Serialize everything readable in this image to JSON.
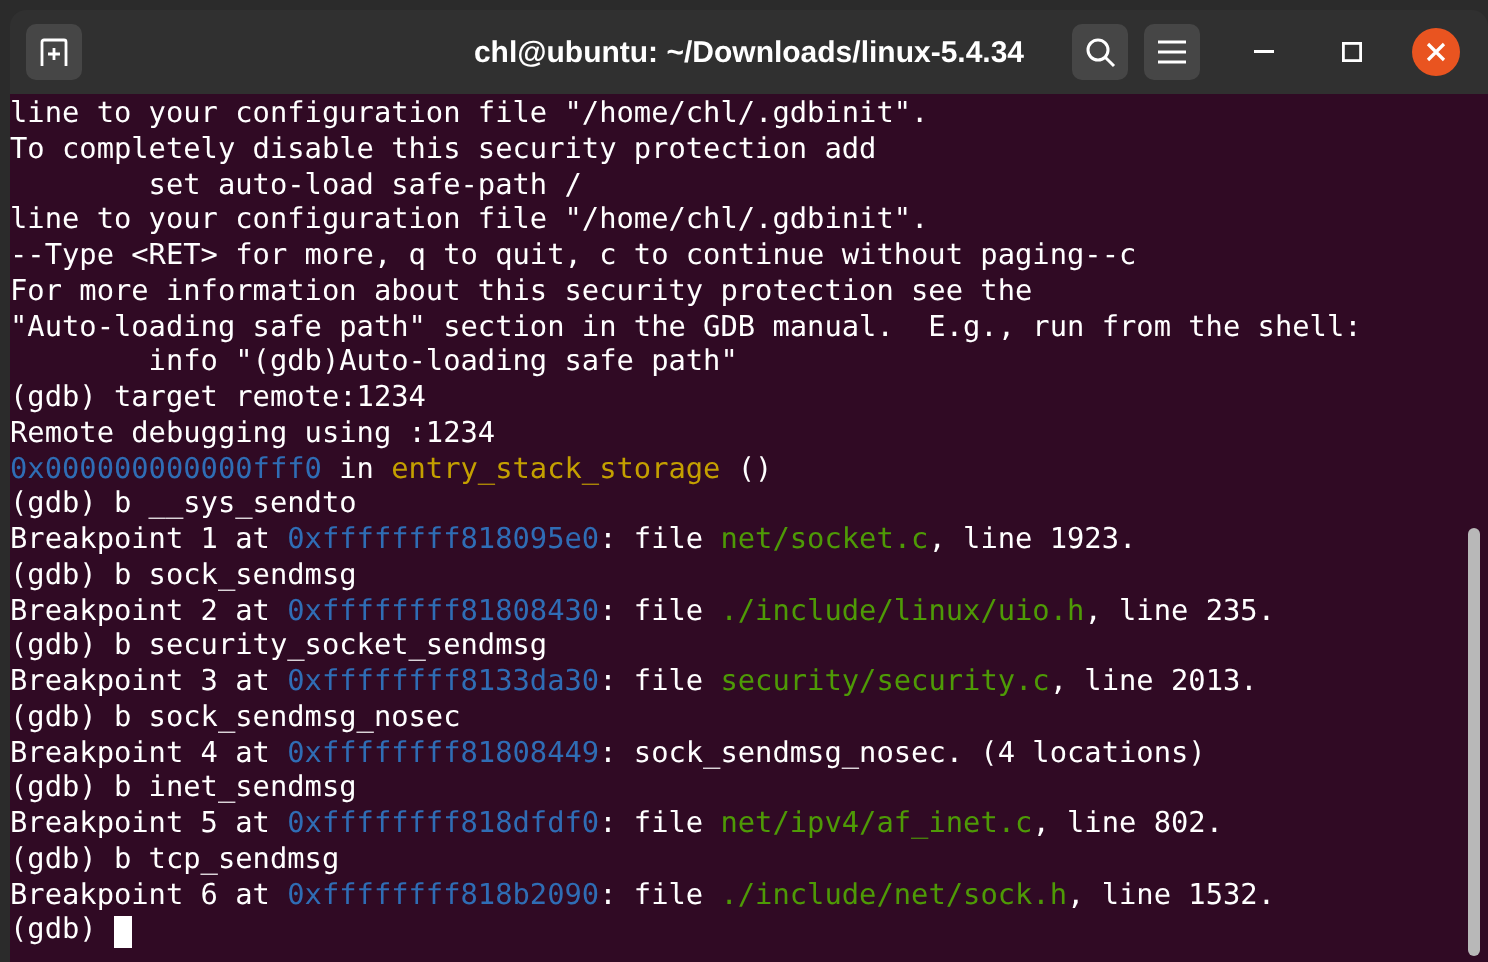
{
  "window": {
    "title": "chl@ubuntu: ~/Downloads/linux-5.4.34"
  },
  "terminal": {
    "lines": [
      {
        "segments": [
          {
            "kind": "plain",
            "text": "line to your configuration file \"/home/chl/.gdbinit\"."
          }
        ]
      },
      {
        "segments": [
          {
            "kind": "plain",
            "text": "To completely disable this security protection add"
          }
        ]
      },
      {
        "segments": [
          {
            "kind": "plain",
            "text": "        set auto-load safe-path /"
          }
        ]
      },
      {
        "segments": [
          {
            "kind": "plain",
            "text": "line to your configuration file \"/home/chl/.gdbinit\"."
          }
        ]
      },
      {
        "segments": [
          {
            "kind": "plain",
            "text": "--Type <RET> for more, q to quit, c to continue without paging--c"
          }
        ]
      },
      {
        "segments": [
          {
            "kind": "plain",
            "text": "For more information about this security protection see the"
          }
        ]
      },
      {
        "segments": [
          {
            "kind": "plain",
            "text": "\"Auto-loading safe path\" section in the GDB manual.  E.g., run from the shell:"
          }
        ]
      },
      {
        "segments": [
          {
            "kind": "plain",
            "text": "        info \"(gdb)Auto-loading safe path\""
          }
        ]
      },
      {
        "segments": [
          {
            "kind": "plain",
            "text": "(gdb) target remote:1234"
          }
        ]
      },
      {
        "segments": [
          {
            "kind": "plain",
            "text": "Remote debugging using :1234"
          }
        ]
      },
      {
        "segments": [
          {
            "kind": "address",
            "text": "0x000000000000fff0"
          },
          {
            "kind": "plain",
            "text": " in "
          },
          {
            "kind": "function",
            "text": "entry_stack_storage"
          },
          {
            "kind": "plain",
            "text": " ()"
          }
        ]
      },
      {
        "segments": [
          {
            "kind": "plain",
            "text": "(gdb) b __sys_sendto"
          }
        ]
      },
      {
        "segments": [
          {
            "kind": "plain",
            "text": "Breakpoint 1 at "
          },
          {
            "kind": "address",
            "text": "0xffffffff818095e0"
          },
          {
            "kind": "plain",
            "text": ": file "
          },
          {
            "kind": "file",
            "text": "net/socket.c"
          },
          {
            "kind": "plain",
            "text": ", line 1923."
          }
        ]
      },
      {
        "segments": [
          {
            "kind": "plain",
            "text": "(gdb) b sock_sendmsg"
          }
        ]
      },
      {
        "segments": [
          {
            "kind": "plain",
            "text": "Breakpoint 2 at "
          },
          {
            "kind": "address",
            "text": "0xffffffff81808430"
          },
          {
            "kind": "plain",
            "text": ": file "
          },
          {
            "kind": "file",
            "text": "./include/linux/uio.h"
          },
          {
            "kind": "plain",
            "text": ", line 235."
          }
        ]
      },
      {
        "segments": [
          {
            "kind": "plain",
            "text": "(gdb) b security_socket_sendmsg"
          }
        ]
      },
      {
        "segments": [
          {
            "kind": "plain",
            "text": "Breakpoint 3 at "
          },
          {
            "kind": "address",
            "text": "0xffffffff8133da30"
          },
          {
            "kind": "plain",
            "text": ": file "
          },
          {
            "kind": "file",
            "text": "security/security.c"
          },
          {
            "kind": "plain",
            "text": ", line 2013."
          }
        ]
      },
      {
        "segments": [
          {
            "kind": "plain",
            "text": "(gdb) b sock_sendmsg_nosec"
          }
        ]
      },
      {
        "segments": [
          {
            "kind": "plain",
            "text": "Breakpoint 4 at "
          },
          {
            "kind": "address",
            "text": "0xffffffff81808449"
          },
          {
            "kind": "plain",
            "text": ": sock_sendmsg_nosec. (4 locations)"
          }
        ]
      },
      {
        "segments": [
          {
            "kind": "plain",
            "text": "(gdb) b inet_sendmsg"
          }
        ]
      },
      {
        "segments": [
          {
            "kind": "plain",
            "text": "Breakpoint 5 at "
          },
          {
            "kind": "address",
            "text": "0xffffffff818dfdf0"
          },
          {
            "kind": "plain",
            "text": ": file "
          },
          {
            "kind": "file",
            "text": "net/ipv4/af_inet.c"
          },
          {
            "kind": "plain",
            "text": ", line 802."
          }
        ]
      },
      {
        "segments": [
          {
            "kind": "plain",
            "text": "(gdb) b tcp_sendmsg"
          }
        ]
      },
      {
        "segments": [
          {
            "kind": "plain",
            "text": "Breakpoint 6 at "
          },
          {
            "kind": "address",
            "text": "0xffffffff818b2090"
          },
          {
            "kind": "plain",
            "text": ": file "
          },
          {
            "kind": "file",
            "text": "./include/net/sock.h"
          },
          {
            "kind": "plain",
            "text": ", line 1532."
          }
        ]
      },
      {
        "segments": [
          {
            "kind": "plain",
            "text": "(gdb) "
          }
        ],
        "cursor": true
      }
    ]
  }
}
